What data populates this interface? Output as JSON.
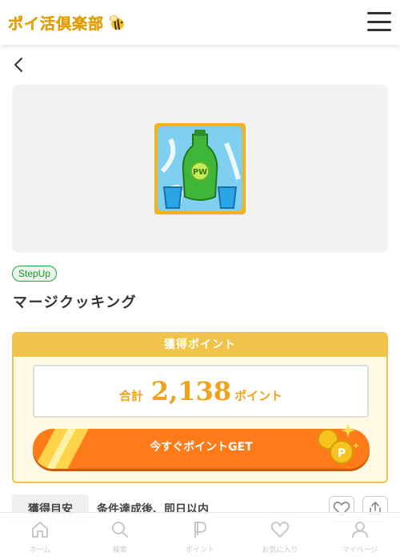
{
  "header": {
    "logo_text": "ポイ活倶楽部",
    "logo_icon": "bee-icon",
    "menu_icon": "hamburger-icon"
  },
  "nav": {
    "back_icon": "chevron-left-icon"
  },
  "offer": {
    "badge": "StepUp",
    "title": "マージクッキング"
  },
  "points": {
    "heading": "獲得ポイント",
    "total_label": "合計",
    "total_value": "2,138",
    "total_unit": "ポイント",
    "cta_label": "今すぐポイントGET"
  },
  "estimate": {
    "label": "獲得目安",
    "value": "条件達成後、即日以内"
  },
  "tabbar": {
    "items": [
      {
        "label": "ホーム",
        "icon": "home-icon"
      },
      {
        "label": "検索",
        "icon": "search-icon"
      },
      {
        "label": "ポイント",
        "icon": "point-icon"
      },
      {
        "label": "お気に入り",
        "icon": "heart-icon"
      },
      {
        "label": "マイページ",
        "icon": "user-icon"
      }
    ]
  },
  "colors": {
    "accent": "#f2c34a",
    "cta": "#ff7b1a",
    "badge": "#2aa33a"
  }
}
